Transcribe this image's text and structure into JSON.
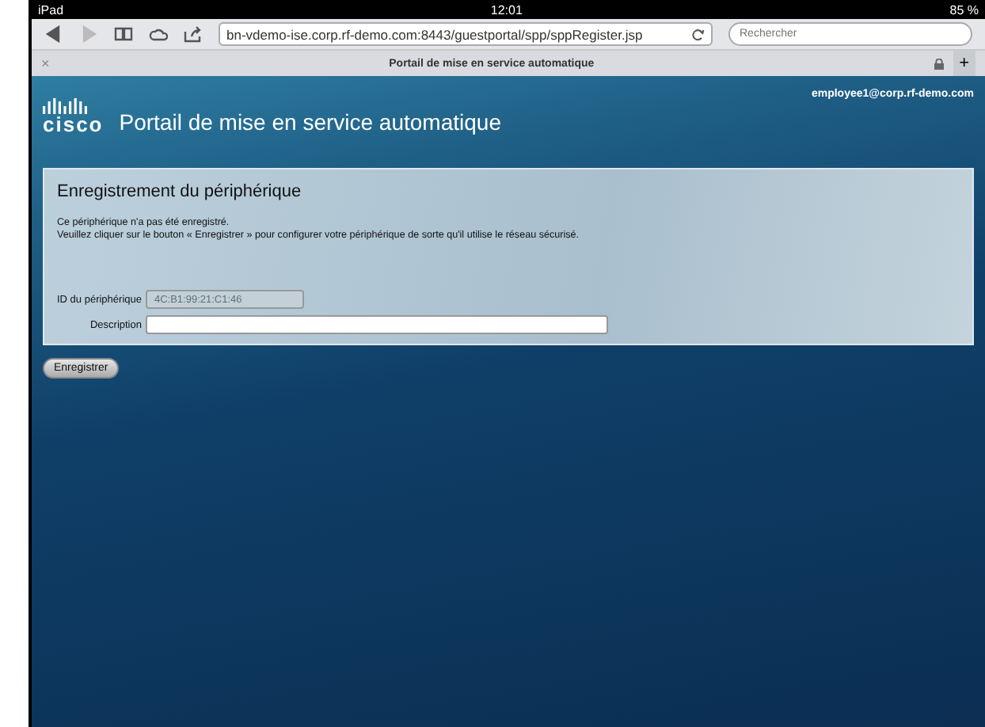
{
  "status_bar": {
    "device": "iPad",
    "time": "12:01",
    "battery": "85 %"
  },
  "browser": {
    "url": "bn-vdemo-ise.corp.rf-demo.com:8443/guestportal/spp/sppRegister.jsp",
    "search": {
      "placeholder": "Rechercher"
    },
    "tab_title": "Portail de mise en service automatique",
    "close": "×",
    "new_tab": "+"
  },
  "header": {
    "logo_text": "cisco",
    "title": "Portail de mise en service automatique",
    "user": "employee1@corp.rf-demo.com"
  },
  "panel": {
    "title": "Enregistrement du périphérique",
    "message": [
      "Ce périphérique n'a pas été enregistré.",
      "Veuillez cliquer sur le bouton « Enregistrer » pour configurer votre périphérique de sorte qu'il utilise le réseau sécurisé."
    ],
    "fields": [
      {
        "label": "ID du périphérique",
        "value": "4C:B1:99:21:C1:46",
        "disabled": true
      },
      {
        "label": "Description",
        "disabled": false
      }
    ]
  },
  "buttons": [
    "Enregistrer"
  ]
}
